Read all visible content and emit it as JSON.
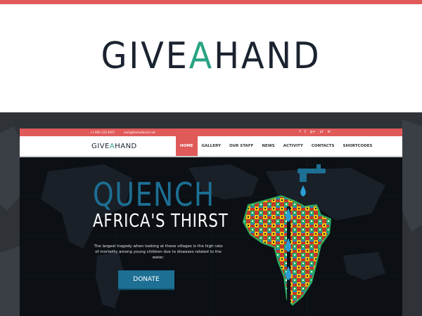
{
  "banner": {
    "logo_part1": "GIVE",
    "logo_accent": "A",
    "logo_part2": "HAND",
    "accent_color": "#e05a5a",
    "logo_accent_color": "#2aa384"
  },
  "site": {
    "topbar": {
      "phone": "+1 800 123 4567",
      "email": "mail@themeforest.net",
      "socials": [
        "f",
        "t",
        "g+",
        "yt",
        "in"
      ]
    },
    "logo": {
      "part1": "GIVE",
      "accent": "A",
      "part2": "HAND"
    },
    "nav": {
      "items": [
        "HOME",
        "GALLERY",
        "OUR STAFF",
        "NEWS",
        "ACTIVITY",
        "CONTACTS",
        "SHORTCODES"
      ],
      "active": "HOME"
    },
    "hero": {
      "title_line1": "QUENCH",
      "title_line2": "AFRICA'S THIRST",
      "description": "The largest tragedy when looking at these villages is the high rate of mortality among young children due to diseases related to the water.",
      "button_label": "DONATE",
      "title_color": "#1d6f94"
    }
  }
}
